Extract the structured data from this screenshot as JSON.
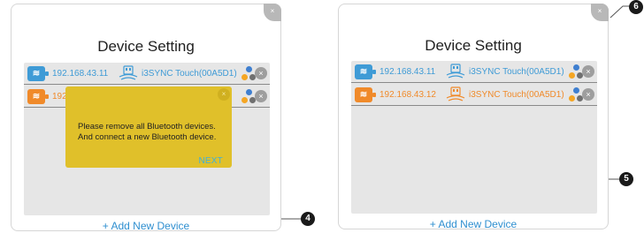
{
  "left_panel": {
    "title": "Device Setting",
    "devices": [
      {
        "ip": "192.168.43.11",
        "name": "i3SYNC Touch(00A5D1)",
        "color": "#3f9bd6"
      },
      {
        "ip": "192.",
        "name": "",
        "color": "#f08a2a"
      }
    ],
    "popup": {
      "message_line1": "Please remove all Bluetooth devices.",
      "message_line2": "And connect a new Bluetooth device.",
      "next_label": "NEXT"
    },
    "add_label": "+ Add New Device"
  },
  "right_panel": {
    "title": "Device Setting",
    "devices": [
      {
        "ip": "192.168.43.11",
        "name": "i3SYNC Touch(00A5D1)",
        "color": "#3f9bd6"
      },
      {
        "ip": "192.168.43.12",
        "name": "i3SYNC Touch(00A5D1)",
        "color": "#f08a2a"
      }
    ],
    "add_label": "+ Add New Device"
  },
  "callouts": {
    "popup_next": "4",
    "device_row": "5",
    "panel_close": "6"
  },
  "colors": {
    "blue": "#3f9bd6",
    "orange": "#f08a2a",
    "popup_yellow": "#e0c02a",
    "dot_blue": "#3f7fd0",
    "dot_orange": "#f5a623",
    "dot_gray": "#707070"
  },
  "icons": {
    "device_badge": "wifi-device-icon",
    "usb": "usb-dongle-icon",
    "dots": "multi-dot-icon",
    "close": "close-icon"
  }
}
